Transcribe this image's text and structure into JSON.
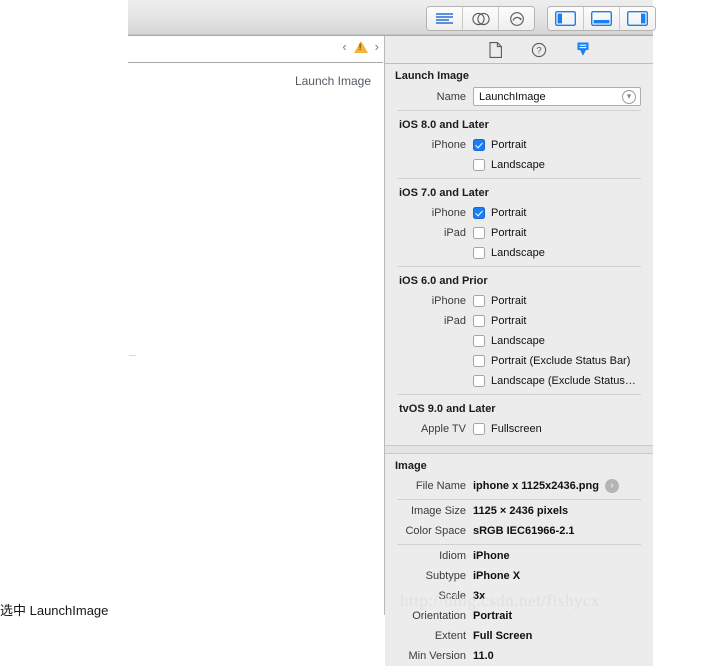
{
  "toolbar": {
    "editor_modes": [
      {
        "name": "standard-editor",
        "icon": "lines-icon"
      },
      {
        "name": "assistant-editor",
        "icon": "venn-circles-icon"
      },
      {
        "name": "version-editor",
        "icon": "clock-arrow-icon"
      }
    ],
    "view_toggles": [
      {
        "name": "navigator-panel",
        "icon": "panel-left-icon",
        "active": true
      },
      {
        "name": "debug-panel",
        "icon": "panel-bottom-icon",
        "active": true
      },
      {
        "name": "utilities-panel",
        "icon": "panel-right-icon",
        "active": true
      }
    ]
  },
  "jumpbar": {
    "back_label": "‹",
    "forward_label": "›",
    "warning_icon": "warning-triangle-icon"
  },
  "canvas": {
    "item_label": "Launch Image"
  },
  "inspector": {
    "tabs": [
      {
        "name": "file-inspector",
        "icon": "document-icon",
        "active": false
      },
      {
        "name": "quick-help-inspector",
        "icon": "question-mark-icon",
        "active": false
      },
      {
        "name": "attributes-inspector",
        "icon": "attributes-arrow-icon",
        "active": true
      }
    ],
    "launch_image": {
      "section_title": "Launch Image",
      "name_label": "Name",
      "name_value": "LaunchImage",
      "groups": [
        {
          "title": "iOS 8.0 and Later",
          "rows": [
            {
              "label": "iPhone",
              "text": "Portrait",
              "checked": true
            },
            {
              "label": "",
              "text": "Landscape",
              "checked": false
            }
          ]
        },
        {
          "title": "iOS 7.0 and Later",
          "rows": [
            {
              "label": "iPhone",
              "text": "Portrait",
              "checked": true
            },
            {
              "label": "iPad",
              "text": "Portrait",
              "checked": false
            },
            {
              "label": "",
              "text": "Landscape",
              "checked": false
            }
          ]
        },
        {
          "title": "iOS 6.0 and Prior",
          "rows": [
            {
              "label": "iPhone",
              "text": "Portrait",
              "checked": false
            },
            {
              "label": "iPad",
              "text": "Portrait",
              "checked": false
            },
            {
              "label": "",
              "text": "Landscape",
              "checked": false
            },
            {
              "label": "",
              "text": "Portrait (Exclude Status Bar)",
              "checked": false
            },
            {
              "label": "",
              "text": "Landscape (Exclude Status…",
              "checked": false
            }
          ]
        },
        {
          "title": "tvOS 9.0 and Later",
          "rows": [
            {
              "label": "Apple TV",
              "text": "Fullscreen",
              "checked": false
            }
          ]
        }
      ]
    },
    "image": {
      "section_title": "Image",
      "file_name_label": "File Name",
      "file_name_value": "iphone x 1125x2436.png",
      "properties": [
        {
          "label": "Image Size",
          "value": "1125 × 2436 pixels"
        },
        {
          "label": "Color Space",
          "value": "sRGB IEC61966-2.1"
        }
      ],
      "attributes": [
        {
          "label": "Idiom",
          "value": "iPhone"
        },
        {
          "label": "Subtype",
          "value": "iPhone X"
        },
        {
          "label": "Scale",
          "value": "3x"
        },
        {
          "label": "Orientation",
          "value": "Portrait"
        },
        {
          "label": "Extent",
          "value": "Full Screen"
        },
        {
          "label": "Min Version",
          "value": "11.0"
        }
      ]
    }
  },
  "watermark": {
    "text": "http://blog.csdn.net/fishycx"
  },
  "footer": {
    "caption": "选中 LaunchImage"
  },
  "colors": {
    "accent_blue": "#1a7ef5",
    "panel_bg": "#ececec",
    "warning_yellow": "#f3b33c"
  }
}
